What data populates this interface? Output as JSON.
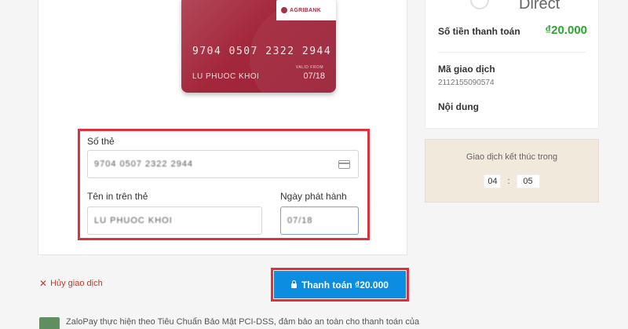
{
  "card": {
    "bank": "AGRIBANK",
    "number": "9704 0507 2322 2944",
    "holder": "LU PHUOC KHOI",
    "valid_label": "VALID FROM",
    "valid": "07/18"
  },
  "form": {
    "card_number_label": "Số thẻ",
    "card_number_value": "9704 0507 2322 2944",
    "name_label": "Tên in trên thẻ",
    "name_value": "LU PHUOC KHOI",
    "issue_date_label": "Ngày phát hành",
    "issue_date_value": "07/18"
  },
  "actions": {
    "cancel_label": "Hủy giao dịch",
    "pay_label": "Thanh toán ₫20.000"
  },
  "footer": {
    "text": "ZaloPay thực hiện theo Tiêu Chuẩn Bảo Mật PCI-DSS, đảm bảo an toàn cho thanh toán của"
  },
  "summary": {
    "provider": "Direct",
    "amount_label": "Số tiền thanh toán",
    "amount": "₫20.000",
    "txn_label": "Mã giao dịch",
    "txn_id": "2112155090574",
    "content_label": "Nội dung"
  },
  "timer": {
    "label": "Giao dịch kết thúc trong",
    "minutes": "04",
    "seconds": "05"
  },
  "colors": {
    "accent": "#0d8de1",
    "highlight": "#e0303e",
    "amount": "#2da62d"
  }
}
